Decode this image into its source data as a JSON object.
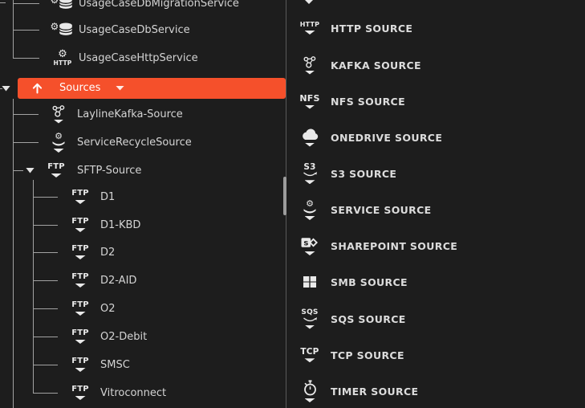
{
  "colors": {
    "background": "#1d1d1d",
    "accent_orange": "#f5502b",
    "divider": "#5a5a5a",
    "tree_line": "#a2a2a2",
    "tree_text": "#d4d4d4",
    "palette_label": "#dcdcdc",
    "icon": "#e9e9e9",
    "scrollbar_thumb": "#9c9c9c"
  },
  "tree": {
    "items": [
      {
        "label": "UsageCaseDbMigrationService",
        "icon": "db-service-icon",
        "level": "service",
        "chevron": false
      },
      {
        "label": "UsageCaseDbService",
        "icon": "db-service-icon",
        "level": "service",
        "chevron": false
      },
      {
        "label": "UsageCaseHttpService",
        "icon": "http-service-icon",
        "level": "service",
        "chevron": false,
        "last_child": true
      },
      {
        "label": "Sources",
        "icon": "arrow-up-icon",
        "level": "selected-root",
        "selected": true,
        "expanded": true,
        "has_dropdown_caret": true
      },
      {
        "label": "LaylineKafka-Source",
        "icon": "kafka-icon",
        "level": "source",
        "chevron": true
      },
      {
        "label": "ServiceRecycleSource",
        "icon": "service-icon",
        "level": "source",
        "chevron": true
      },
      {
        "label": "SFTP-Source",
        "icon": "text-icon",
        "icon_text": "FTP",
        "level": "source-expandable",
        "expanded": true,
        "chevron": true
      },
      {
        "label": "D1",
        "icon": "text-icon",
        "icon_text": "FTP",
        "level": "sftp-child",
        "chevron": true
      },
      {
        "label": "D1-KBD",
        "icon": "text-icon",
        "icon_text": "FTP",
        "level": "sftp-child",
        "chevron": true
      },
      {
        "label": "D2",
        "icon": "text-icon",
        "icon_text": "FTP",
        "level": "sftp-child",
        "chevron": true
      },
      {
        "label": "D2-AID",
        "icon": "text-icon",
        "icon_text": "FTP",
        "level": "sftp-child",
        "chevron": true
      },
      {
        "label": "O2",
        "icon": "text-icon",
        "icon_text": "FTP",
        "level": "sftp-child",
        "chevron": true
      },
      {
        "label": "O2-Debit",
        "icon": "text-icon",
        "icon_text": "FTP",
        "level": "sftp-child",
        "chevron": true
      },
      {
        "label": "SMSC",
        "icon": "text-icon",
        "icon_text": "FTP",
        "level": "sftp-child",
        "chevron": true
      },
      {
        "label": "Vitroconnect",
        "icon": "text-icon",
        "icon_text": "FTP",
        "level": "sftp-child",
        "chevron": true,
        "last_child": true
      }
    ]
  },
  "palette": {
    "items": [
      {
        "label": "HTTP SOURCE",
        "icon": "text-icon",
        "icon_text": "HTTP",
        "chevron": true
      },
      {
        "label": "KAFKA SOURCE",
        "icon": "kafka-icon",
        "chevron": true
      },
      {
        "label": "NFS SOURCE",
        "icon": "text-icon",
        "icon_text": "NFS",
        "chevron": true
      },
      {
        "label": "ONEDRIVE SOURCE",
        "icon": "cloud-icon",
        "chevron": true
      },
      {
        "label": "S3 SOURCE",
        "icon": "text-icon",
        "icon_text": "S3",
        "smile": true,
        "chevron": true
      },
      {
        "label": "SERVICE SOURCE",
        "icon": "service-icon",
        "chevron": true
      },
      {
        "label": "SHAREPOINT SOURCE",
        "icon": "sharepoint-icon",
        "chevron": true
      },
      {
        "label": "SMB SOURCE",
        "icon": "windows-icon",
        "chevron": false
      },
      {
        "label": "SQS SOURCE",
        "icon": "text-icon",
        "icon_text": "SQS",
        "smile": true,
        "chevron": true
      },
      {
        "label": "TCP SOURCE",
        "icon": "text-icon",
        "icon_text": "TCP",
        "chevron": true
      },
      {
        "label": "TIMER SOURCE",
        "icon": "timer-icon",
        "chevron": true
      }
    ]
  }
}
